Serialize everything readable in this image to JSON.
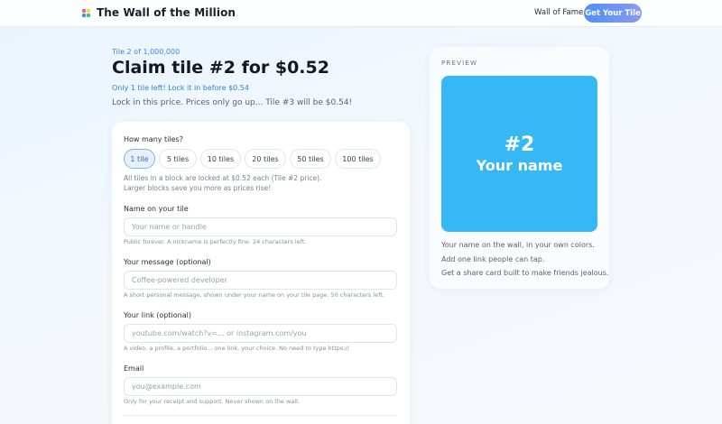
{
  "header": {
    "brand": "The Wall of the Million",
    "nav_link": "Wall of Fame",
    "cta_label": "Get Your Tile"
  },
  "intro": {
    "tile_count": "Tile 2 of 1,000,000",
    "title": "Claim tile #2 for $0.52",
    "urgency": "Only 1 tile left! Lock it in before $0.54",
    "subtext": "Lock in this price. Prices only go up... Tile #3 will be $0.54!"
  },
  "form": {
    "tiles_label": "How many tiles?",
    "tile_options": [
      "1 tile",
      "5 tiles",
      "10 tiles",
      "20 tiles",
      "50 tiles",
      "100 tiles"
    ],
    "selected_option": "1 tile",
    "block_note_1": "All tiles in a block are locked at $0.52 each (Tile #2 price).",
    "block_note_2": "Larger blocks save you more as prices rise!",
    "name": {
      "label": "Name on your tile",
      "placeholder": "Your name or handle",
      "value": "",
      "hint": "Public forever. A nickname is perfectly fine. 24 characters left."
    },
    "message": {
      "label": "Your message (optional)",
      "placeholder": "Coffee-powered developer",
      "value": "",
      "hint": "A short personal message, shown under your name on your tile page. 50 characters left."
    },
    "link": {
      "label": "Your link (optional)",
      "placeholder": "youtube.com/watch?v=... or instagram.com/you",
      "value": "",
      "hint": "A video, a profile, a portfolio... one link, your choice. No need to type https://"
    },
    "email": {
      "label": "Email",
      "placeholder": "you@example.com",
      "value": "",
      "hint": "Only for your receipt and support. Never shown on the wall."
    }
  },
  "preview": {
    "label": "PREVIEW",
    "tile_number": "#2",
    "tile_name": "Your name",
    "tile_color": "#36b8f5",
    "benefits": [
      "Your name on the wall, in your own colors.",
      "Add one link people can tap.",
      "Get a share card built to make friends jealous."
    ]
  },
  "colors": {
    "accent": "#3b86e0",
    "cta_gradient_start": "#4f8ef7",
    "cta_gradient_end": "#8a9bf0"
  }
}
